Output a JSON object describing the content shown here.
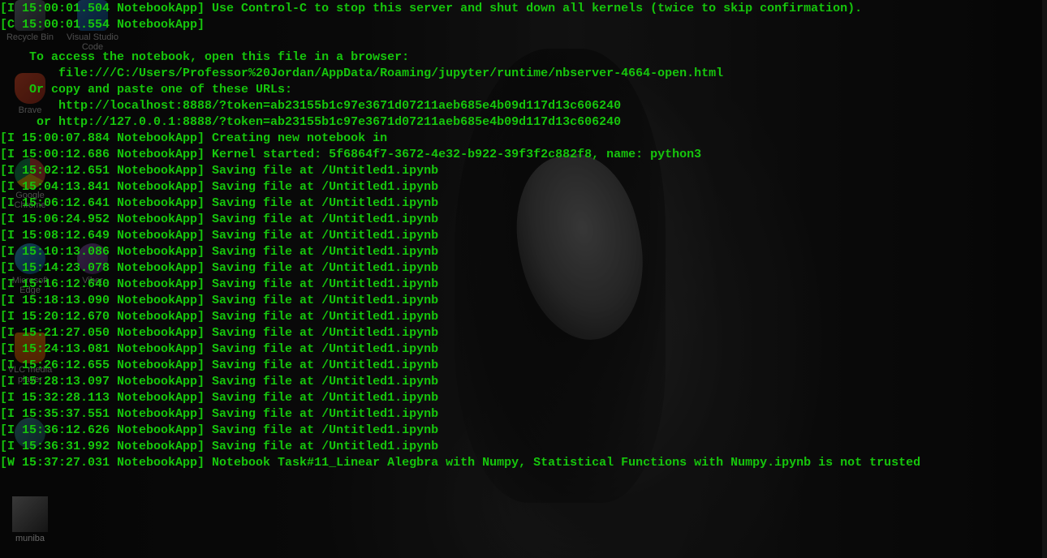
{
  "terminal": {
    "text_color": "#16c60c",
    "lines": [
      "[I 15:00:01.504 NotebookApp] Use Control-C to stop this server and shut down all kernels (twice to skip confirmation).",
      "[C 15:00:01.554 NotebookApp]",
      "",
      "    To access the notebook, open this file in a browser:",
      "        file:///C:/Users/Professor%20Jordan/AppData/Roaming/jupyter/runtime/nbserver-4664-open.html",
      "    Or copy and paste one of these URLs:",
      "        http://localhost:8888/?token=ab23155b1c97e3671d07211aeb685e4b09d117d13c606240",
      "     or http://127.0.0.1:8888/?token=ab23155b1c97e3671d07211aeb685e4b09d117d13c606240",
      "[I 15:00:07.884 NotebookApp] Creating new notebook in",
      "[I 15:00:12.686 NotebookApp] Kernel started: 5f6864f7-3672-4e32-b922-39f3f2c882f8, name: python3",
      "[I 15:02:12.651 NotebookApp] Saving file at /Untitled1.ipynb",
      "[I 15:04:13.841 NotebookApp] Saving file at /Untitled1.ipynb",
      "[I 15:06:12.641 NotebookApp] Saving file at /Untitled1.ipynb",
      "[I 15:06:24.952 NotebookApp] Saving file at /Untitled1.ipynb",
      "[I 15:08:12.649 NotebookApp] Saving file at /Untitled1.ipynb",
      "[I 15:10:13.086 NotebookApp] Saving file at /Untitled1.ipynb",
      "[I 15:14:23.078 NotebookApp] Saving file at /Untitled1.ipynb",
      "[I 15:16:12.640 NotebookApp] Saving file at /Untitled1.ipynb",
      "[I 15:18:13.090 NotebookApp] Saving file at /Untitled1.ipynb",
      "[I 15:20:12.670 NotebookApp] Saving file at /Untitled1.ipynb",
      "[I 15:21:27.050 NotebookApp] Saving file at /Untitled1.ipynb",
      "[I 15:24:13.081 NotebookApp] Saving file at /Untitled1.ipynb",
      "[I 15:26:12.655 NotebookApp] Saving file at /Untitled1.ipynb",
      "[I 15:28:13.097 NotebookApp] Saving file at /Untitled1.ipynb",
      "[I 15:32:28.113 NotebookApp] Saving file at /Untitled1.ipynb",
      "[I 15:35:37.551 NotebookApp] Saving file at /Untitled1.ipynb",
      "[I 15:36:12.626 NotebookApp] Saving file at /Untitled1.ipynb",
      "[I 15:36:31.992 NotebookApp] Saving file at /Untitled1.ipynb",
      "[W 15:37:27.031 NotebookApp] Notebook Task#11_Linear Alegbra with Numpy, Statistical Functions with Numpy.ipynb is not trusted"
    ]
  },
  "desktop": {
    "icons": [
      {
        "label": "Recycle Bin",
        "icon": "recycle-bin-icon"
      },
      {
        "label": "Visual Studio Code",
        "icon": "vscode-icon"
      },
      {
        "label": "Brave",
        "icon": "brave-icon"
      },
      {
        "label": "Google Chrome",
        "icon": "chrome-icon"
      },
      {
        "label": "Microsoft Edge",
        "icon": "edge-icon"
      },
      {
        "label": "Viber",
        "icon": "viber-icon"
      },
      {
        "label": "VLC media player",
        "icon": "vlc-icon"
      },
      {
        "label": "",
        "icon": "app-icon"
      },
      {
        "label": "muniba",
        "icon": "folder-image-icon"
      }
    ]
  }
}
